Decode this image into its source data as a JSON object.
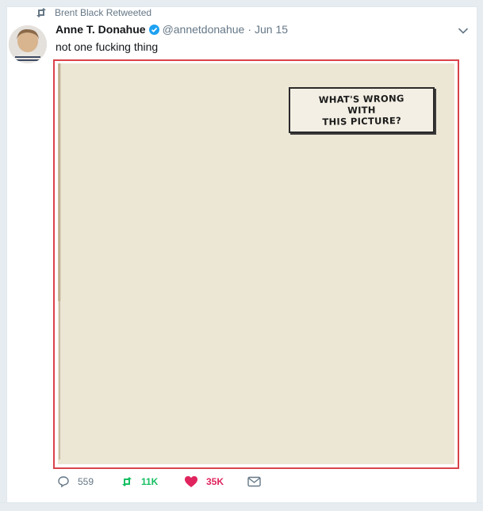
{
  "retweet_context": {
    "text": "Brent Black Retweeted",
    "icon": "retweet-icon"
  },
  "tweet": {
    "fullname": "Anne T. Donahue",
    "verified_icon": "verified-badge-icon",
    "username": "@annetdonahue",
    "separator": "·",
    "timestamp": "Jun 15",
    "text": "not one fucking thing",
    "media": {
      "caption": "WHAT'S WRONG\nWITH\nTHIS PICTURE?"
    }
  },
  "actions": {
    "reply_count": "559",
    "retweet_count": "11K",
    "like_count": "35K"
  },
  "colors": {
    "retweet": "#17bf63",
    "like": "#e0245e",
    "verified": "#1da1f2",
    "muted": "#657786",
    "highlight_border": "#d9434b"
  }
}
